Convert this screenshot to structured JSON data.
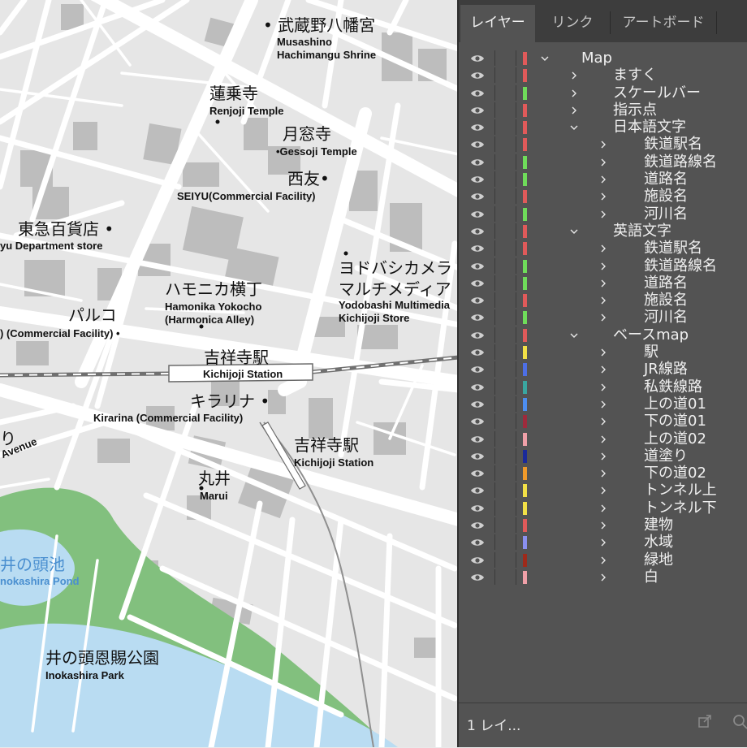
{
  "map": {
    "labels": [
      {
        "id": "musashino-ja",
        "text": "• 武蔵野八幡宮",
        "cls": "ja"
      },
      {
        "id": "musashino-en1",
        "text": "Musashino",
        "cls": "en"
      },
      {
        "id": "musashino-en2",
        "text": "Hachimangu Shrine",
        "cls": "en"
      },
      {
        "id": "renjoji-ja",
        "text": "蓮乗寺",
        "cls": "ja"
      },
      {
        "id": "renjoji-en",
        "text": "Renjoji Temple",
        "cls": "en"
      },
      {
        "id": "gessoji-ja",
        "text": "月窓寺",
        "cls": "ja"
      },
      {
        "id": "gessoji-en",
        "text": "•Gessoji Temple",
        "cls": "en"
      },
      {
        "id": "seiyu-ja",
        "text": "西友•",
        "cls": "ja"
      },
      {
        "id": "seiyu-en",
        "text": "SEIYU(Commercial Facility)",
        "cls": "en"
      },
      {
        "id": "tokyu-ja",
        "text": "東急百貨店 •",
        "cls": "ja"
      },
      {
        "id": "tokyu-en",
        "text": "yu Department store",
        "cls": "en"
      },
      {
        "id": "yodobashi-ja1",
        "text": "ヨドバシカメラ",
        "cls": "ja"
      },
      {
        "id": "yodobashi-ja2",
        "text": "マルチメディア",
        "cls": "ja"
      },
      {
        "id": "yodobashi-en1",
        "text": "Yodobashi Multimedia",
        "cls": "en"
      },
      {
        "id": "yodobashi-en2",
        "text": "Kichijoji Store",
        "cls": "en"
      },
      {
        "id": "harmonica-ja",
        "text": "ハモニカ横丁",
        "cls": "ja"
      },
      {
        "id": "harmonica-en1",
        "text": "Hamonika Yokocho",
        "cls": "en"
      },
      {
        "id": "harmonica-en2",
        "text": "(Harmonica Alley)",
        "cls": "en"
      },
      {
        "id": "parco-ja",
        "text": "パルコ",
        "cls": "ja"
      },
      {
        "id": "parco-en",
        "text": ") (Commercial Facility) •",
        "cls": "en"
      },
      {
        "id": "station1-ja",
        "text": "吉祥寺駅",
        "cls": "ja"
      },
      {
        "id": "station1-en",
        "text": "Kichijoji Station",
        "cls": "en"
      },
      {
        "id": "kirarina-ja",
        "text": "キラリナ •",
        "cls": "ja"
      },
      {
        "id": "kirarina-en",
        "text": "Kirarina (Commercial Facility)",
        "cls": "en"
      },
      {
        "id": "station2-ja",
        "text": "吉祥寺駅",
        "cls": "ja"
      },
      {
        "id": "station2-en",
        "text": "Kichijoji Station",
        "cls": "en"
      },
      {
        "id": "marui-ja",
        "text": "丸井",
        "cls": "ja"
      },
      {
        "id": "marui-en",
        "text": "Marui",
        "cls": "en"
      },
      {
        "id": "inokashira-pond-ja",
        "text": "井の頭池",
        "cls": "ja blue"
      },
      {
        "id": "inokashira-pond-en",
        "text": "nokashira Pond",
        "cls": "en blue"
      },
      {
        "id": "inokashira-park-ja",
        "text": "井の頭恩賜公園",
        "cls": "ja"
      },
      {
        "id": "inokashira-park-en",
        "text": "Inokashira Park",
        "cls": "en"
      },
      {
        "id": "avenue-ja",
        "text": "り",
        "cls": "ja"
      },
      {
        "id": "avenue-en",
        "text": "Avenue",
        "cls": "en"
      }
    ]
  },
  "panel": {
    "tabs": [
      "レイヤー",
      "リンク",
      "アートボード"
    ],
    "active_tab": 0,
    "layers": [
      {
        "name": "Map",
        "depth": 0,
        "expanded": true,
        "color": "#e05a5a"
      },
      {
        "name": "ますく",
        "depth": 1,
        "expanded": false,
        "color": "#e05a5a"
      },
      {
        "name": "スケールバー",
        "depth": 1,
        "expanded": false,
        "color": "#6fdc5a"
      },
      {
        "name": "指示点",
        "depth": 1,
        "expanded": false,
        "color": "#e05a5a"
      },
      {
        "name": "日本語文字",
        "depth": 1,
        "expanded": true,
        "color": "#e05a5a"
      },
      {
        "name": "鉄道駅名",
        "depth": 2,
        "expanded": false,
        "color": "#e05a5a"
      },
      {
        "name": "鉄道路線名",
        "depth": 2,
        "expanded": false,
        "color": "#6fdc5a"
      },
      {
        "name": "道路名",
        "depth": 2,
        "expanded": false,
        "color": "#6fdc5a"
      },
      {
        "name": "施設名",
        "depth": 2,
        "expanded": false,
        "color": "#e05a5a"
      },
      {
        "name": "河川名",
        "depth": 2,
        "expanded": false,
        "color": "#6fdc5a"
      },
      {
        "name": "英語文字",
        "depth": 1,
        "expanded": true,
        "color": "#e05a5a"
      },
      {
        "name": "鉄道駅名",
        "depth": 2,
        "expanded": false,
        "color": "#e05a5a"
      },
      {
        "name": "鉄道路線名",
        "depth": 2,
        "expanded": false,
        "color": "#6fdc5a"
      },
      {
        "name": "道路名",
        "depth": 2,
        "expanded": false,
        "color": "#6fdc5a"
      },
      {
        "name": "施設名",
        "depth": 2,
        "expanded": false,
        "color": "#e05a5a"
      },
      {
        "name": "河川名",
        "depth": 2,
        "expanded": false,
        "color": "#6fdc5a"
      },
      {
        "name": "ベースmap",
        "depth": 1,
        "expanded": true,
        "color": "#e05a5a"
      },
      {
        "name": "駅",
        "depth": 2,
        "expanded": false,
        "color": "#f2e046"
      },
      {
        "name": "JR線路",
        "depth": 2,
        "expanded": false,
        "color": "#4d6fe6"
      },
      {
        "name": "私鉄線路",
        "depth": 2,
        "expanded": false,
        "color": "#3aa6a0"
      },
      {
        "name": "上の道01",
        "depth": 2,
        "expanded": false,
        "color": "#4d8ef0"
      },
      {
        "name": "下の道01",
        "depth": 2,
        "expanded": false,
        "color": "#9e2a3c"
      },
      {
        "name": "上の道02",
        "depth": 2,
        "expanded": false,
        "color": "#f0a0a8"
      },
      {
        "name": "道塗り",
        "depth": 2,
        "expanded": false,
        "color": "#1a2a9a"
      },
      {
        "name": "下の道02",
        "depth": 2,
        "expanded": false,
        "color": "#f09a2a"
      },
      {
        "name": "トンネル上",
        "depth": 2,
        "expanded": false,
        "color": "#f2e046"
      },
      {
        "name": "トンネル下",
        "depth": 2,
        "expanded": false,
        "color": "#f2e046"
      },
      {
        "name": "建物",
        "depth": 2,
        "expanded": false,
        "color": "#e05a5a"
      },
      {
        "name": "水域",
        "depth": 2,
        "expanded": false,
        "color": "#8a90f0"
      },
      {
        "name": "緑地",
        "depth": 2,
        "expanded": false,
        "color": "#9e2a1a"
      },
      {
        "name": "白",
        "depth": 2,
        "expanded": false,
        "color": "#f0a0a8"
      }
    ],
    "footer_count": "1 レイ..."
  }
}
